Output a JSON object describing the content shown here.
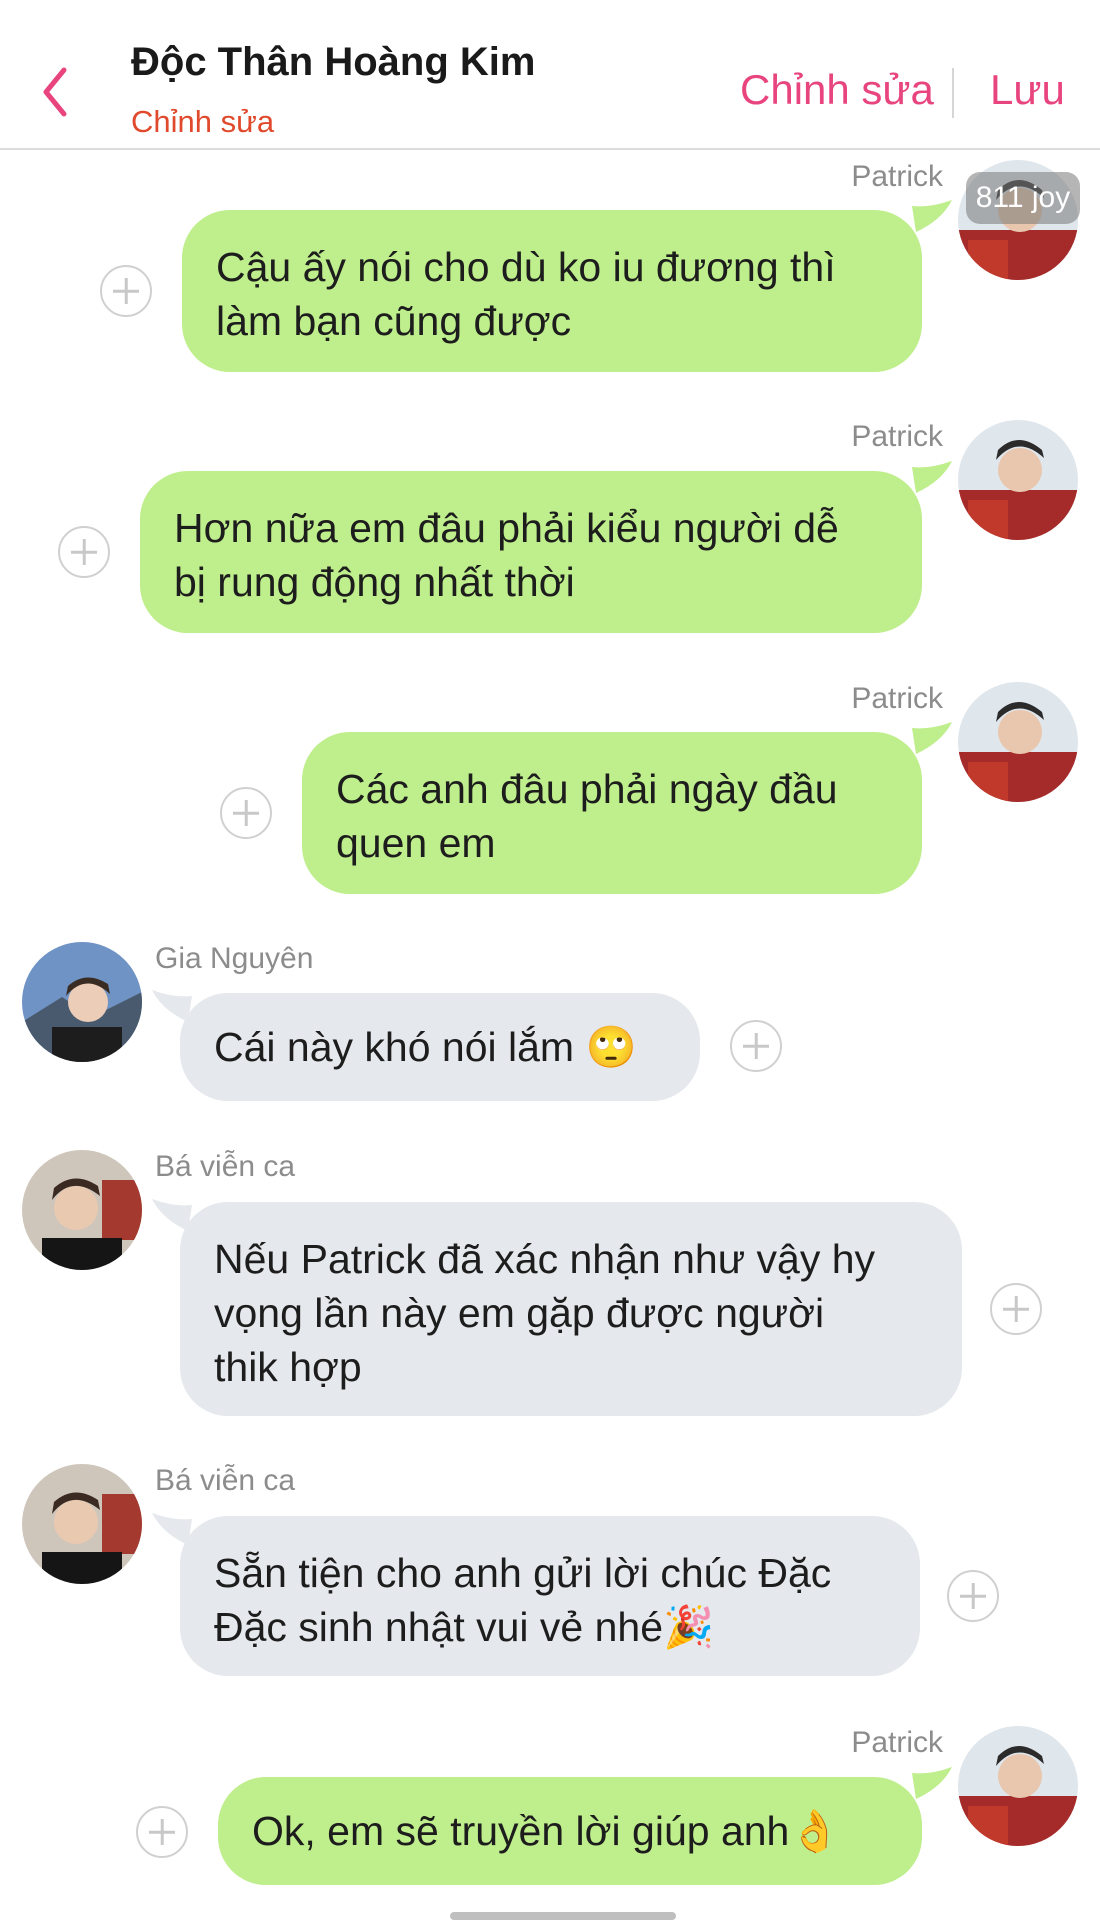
{
  "header": {
    "title": "Độc Thân Hoàng Kim",
    "subtitle": "Chỉnh sửa",
    "edit_label": "Chỉnh sửa",
    "save_label": "Lưu"
  },
  "watermark": "811 joy",
  "messages": [
    {
      "sender": "Patrick",
      "side": "right",
      "text_lines": [
        "Cậu ấy nói cho dù ko iu đương thì",
        "làm bạn cũng được"
      ]
    },
    {
      "sender": "Patrick",
      "side": "right",
      "text_lines": [
        "Hơn nữa em đâu phải kiểu người dễ",
        "bị rung động nhất thời"
      ]
    },
    {
      "sender": "Patrick",
      "side": "right",
      "text_lines": [
        "Các anh đâu phải ngày đầu",
        "quen em"
      ]
    },
    {
      "sender": "Gia Nguyên",
      "side": "left",
      "text_lines": [
        "Cái này khó nói lắm 🙄"
      ]
    },
    {
      "sender": "Bá viễn ca",
      "side": "left",
      "text_lines": [
        "Nếu Patrick đã xác nhận như vậy hy",
        "vọng lần này em gặp được người",
        "thik hợp"
      ]
    },
    {
      "sender": "Bá viễn ca",
      "side": "left",
      "text_lines": [
        "Sẵn tiện cho anh gửi lời chúc Đặc",
        "Đặc sinh nhật vui vẻ nhé🎉"
      ]
    },
    {
      "sender": "Patrick",
      "side": "right",
      "text_lines": [
        "Ok, em sẽ truyền lời giúp anh👌"
      ]
    }
  ],
  "colors": {
    "accent": "#e8457f",
    "subtitle": "#e0492c",
    "outgoing_bubble": "#bfee8c",
    "incoming_bubble": "#e5e8ec"
  },
  "icons": {
    "back": "chevron-left-icon",
    "add_reaction": "plus-circle-icon"
  }
}
